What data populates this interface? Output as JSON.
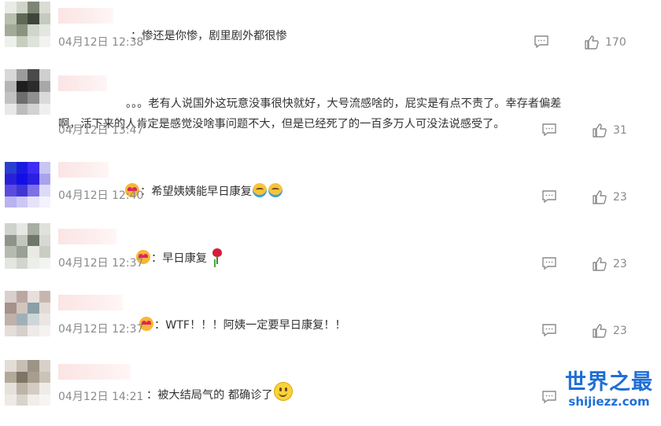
{
  "comments": [
    {
      "text": "：惨还是你惨，剧里剧外都很惨",
      "time": "04月12日 12:38",
      "likes": "170",
      "avatar_colors": [
        "#e9ece6",
        "#cfd4c9",
        "#7d8675",
        "#d9ddd4",
        "#b7bfae",
        "#5f6a56",
        "#3e463a",
        "#c4cabd",
        "#a3ab98",
        "#8a9380",
        "#d0d6ca",
        "#e4e7e0",
        "#eef0ec",
        "#c8ceb f",
        "#dfe3da",
        "#f2f3f0"
      ]
    },
    {
      "text": "。。。老有人说国外这玩意没事很快就好，大号流感啥的，屁实是有点不责了。幸存者偏差\n啊，活下来的人肯定是感觉没啥事问题不大，但是已经死了的一百多万人可没法说感受了。",
      "time": "04月12日 13:47",
      "likes": "31",
      "avatar_colors": [
        "#d8d8d8",
        "#9c9c9c",
        "#4a4a4a",
        "#cfcfcf",
        "#b5b5b5",
        "#1e1e1e",
        "#2b2b2b",
        "#a8a8a8",
        "#c2c2c2",
        "#6d6d6d",
        "#8f8f8f",
        "#dadada",
        "#e8e8e8",
        "#bdbdbd",
        "#d2d2d2",
        "#efefef"
      ]
    },
    {
      "text": "：希望姨姨能早日康复",
      "time": "04月12日 12:40",
      "likes": "23",
      "avatar_colors": [
        "#2a3fcf",
        "#1a1ae0",
        "#3d2cf2",
        "#c9c6f5",
        "#2820d8",
        "#120fe6",
        "#2b1fe0",
        "#a9a3ee",
        "#5b4ae0",
        "#4036d6",
        "#7d70e6",
        "#ded9f7",
        "#b9b3ef",
        "#cdc7f3",
        "#e6e3f9",
        "#f4f2fc"
      ]
    },
    {
      "text": "：早日康复",
      "time": "04月12日 12:37",
      "likes": "23",
      "avatar_colors": [
        "#cfd3cc",
        "#e6e8e3",
        "#a9aea4",
        "#dfe1db",
        "#8e9489",
        "#c3c7bd",
        "#6f766a",
        "#d7dad2",
        "#b6bbb0",
        "#9aa094",
        "#e9eae6",
        "#c9cdc4",
        "#e3e5df",
        "#d2d5cd",
        "#eceeea",
        "#f3f4f1"
      ]
    },
    {
      "text": "：WTF！！！阿姨一定要早日康复！！",
      "time": "04月12日 12:37",
      "likes": "23",
      "avatar_colors": [
        "#d9cfcb",
        "#b9a8a2",
        "#e8dfdc",
        "#c7b6b0",
        "#a4928b",
        "#d3c4be",
        "#8aa0a6",
        "#e3dad6",
        "#bfb0aa",
        "#9fb1b6",
        "#cdd6d8",
        "#ece6e3",
        "#e4ddda",
        "#d7cfcb",
        "#efeae8",
        "#f5f2f1"
      ]
    },
    {
      "text": "：被大结局气的 都确诊了",
      "time": "04月12日 14:21",
      "likes": "",
      "avatar_colors": [
        "#e2ddd6",
        "#c7bfb4",
        "#9e9486",
        "#d8d1c8",
        "#b3a99b",
        "#7f7566",
        "#a89d8e",
        "#ccc3b8",
        "#e6e1db",
        "#bdb3a6",
        "#d3ccc2",
        "#efece8",
        "#eeeae5",
        "#d9d3cb",
        "#f1eeea",
        "#f7f5f2"
      ]
    }
  ],
  "watermark": {
    "cn": "世界之最",
    "en": "shijiezz.com"
  },
  "colors": {
    "text": "#333333",
    "meta": "#8a8a8a",
    "watermark": "#1f6fd6"
  }
}
